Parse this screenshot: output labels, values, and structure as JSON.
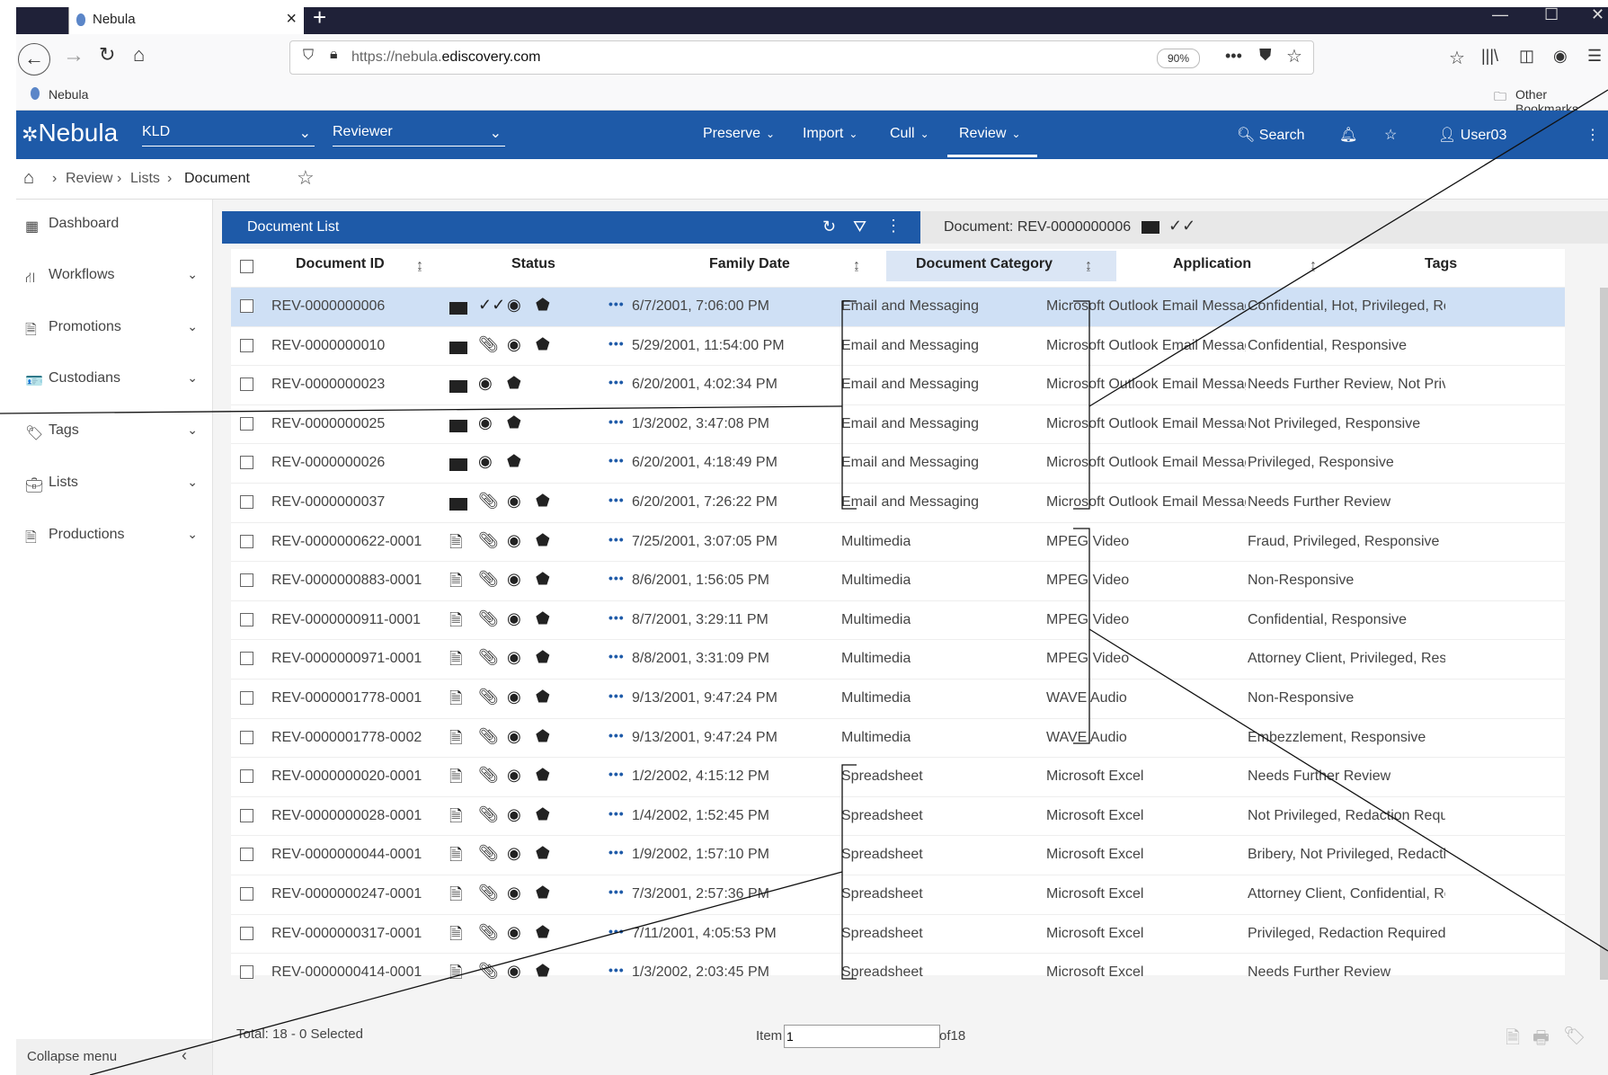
{
  "browser": {
    "tab_title": "Nebula",
    "url_prefix": "https://nebula.",
    "url_domain": "ediscovery.com",
    "zoom": "90%",
    "bookmark": "Nebula",
    "other_bookmarks": "Other Bookmarks"
  },
  "header": {
    "logo": "Nebula",
    "org": "KLD",
    "role": "Reviewer",
    "nav": [
      "Preserve",
      "Import",
      "Cull",
      "Review"
    ],
    "search": "Search",
    "user": "User03"
  },
  "breadcrumb": [
    "Review",
    "Lists",
    "Document"
  ],
  "sidebar": {
    "items": [
      {
        "label": "Dashboard",
        "icon": "dashboard-icon"
      },
      {
        "label": "Workflows",
        "icon": "sitemap-icon"
      },
      {
        "label": "Promotions",
        "icon": "file-icon"
      },
      {
        "label": "Custodians",
        "icon": "badge-icon"
      },
      {
        "label": "Tags",
        "icon": "tag-icon"
      },
      {
        "label": "Lists",
        "icon": "briefcase-icon"
      },
      {
        "label": "Productions",
        "icon": "file-export-icon"
      }
    ],
    "collapse": "Collapse menu"
  },
  "doclist": {
    "title": "Document List",
    "doc_info": "Document: REV-0000000006"
  },
  "columns": [
    "Document ID",
    "Status",
    "Family Date",
    "Document Category",
    "Application",
    "Tags"
  ],
  "rows": [
    {
      "id": "REV-0000000006",
      "date": "6/7/2001, 7:06:00 PM",
      "cat": "Email and Messaging",
      "app": "Microsoft Outlook Email Message",
      "tags": "Confidential, Hot, Privileged, Re...",
      "type": "email",
      "clip": false,
      "check": true
    },
    {
      "id": "REV-0000000010",
      "date": "5/29/2001, 11:54:00 PM",
      "cat": "Email and Messaging",
      "app": "Microsoft Outlook Email Message",
      "tags": "Confidential, Responsive",
      "type": "email",
      "clip": true,
      "check": false
    },
    {
      "id": "REV-0000000023",
      "date": "6/20/2001, 4:02:34 PM",
      "cat": "Email and Messaging",
      "app": "Microsoft Outlook Email Message",
      "tags": "Needs Further Review, Not Privil...",
      "type": "email",
      "clip": false,
      "check": false
    },
    {
      "id": "REV-0000000025",
      "date": "1/3/2002, 3:47:08 PM",
      "cat": "Email and Messaging",
      "app": "Microsoft Outlook Email Message",
      "tags": "Not Privileged, Responsive",
      "type": "email",
      "clip": false,
      "check": false
    },
    {
      "id": "REV-0000000026",
      "date": "6/20/2001, 4:18:49 PM",
      "cat": "Email and Messaging",
      "app": "Microsoft Outlook Email Message",
      "tags": "Privileged, Responsive",
      "type": "email",
      "clip": false,
      "check": false
    },
    {
      "id": "REV-0000000037",
      "date": "6/20/2001, 7:26:22 PM",
      "cat": "Email and Messaging",
      "app": "Microsoft Outlook Email Message",
      "tags": "Needs Further Review",
      "type": "email",
      "clip": true,
      "check": false
    },
    {
      "id": "REV-0000000622-0001",
      "date": "7/25/2001, 3:07:05 PM",
      "cat": "Multimedia",
      "app": "MPEG Video",
      "tags": "Fraud, Privileged, Responsive",
      "type": "media",
      "clip": true,
      "check": false
    },
    {
      "id": "REV-0000000883-0001",
      "date": "8/6/2001, 1:56:05 PM",
      "cat": "Multimedia",
      "app": "MPEG Video",
      "tags": "Non-Responsive",
      "type": "media",
      "clip": true,
      "check": false
    },
    {
      "id": "REV-0000000911-0001",
      "date": "8/7/2001, 3:29:11 PM",
      "cat": "Multimedia",
      "app": "MPEG Video",
      "tags": "Confidential, Responsive",
      "type": "media",
      "clip": true,
      "check": false
    },
    {
      "id": "REV-0000000971-0001",
      "date": "8/8/2001, 3:31:09 PM",
      "cat": "Multimedia",
      "app": "MPEG Video",
      "tags": "Attorney Client, Privileged, Res...",
      "type": "media",
      "clip": true,
      "check": false
    },
    {
      "id": "REV-0000001778-0001",
      "date": "9/13/2001, 9:47:24 PM",
      "cat": "Multimedia",
      "app": "WAVE Audio",
      "tags": "Non-Responsive",
      "type": "media",
      "clip": true,
      "check": false
    },
    {
      "id": "REV-0000001778-0002",
      "date": "9/13/2001, 9:47:24 PM",
      "cat": "Multimedia",
      "app": "WAVE Audio",
      "tags": "Embezzlement, Responsive",
      "type": "media",
      "clip": true,
      "check": false
    },
    {
      "id": "REV-0000000020-0001",
      "date": "1/2/2002, 4:15:12 PM",
      "cat": "Spreadsheet",
      "app": "Microsoft Excel",
      "tags": "Needs Further Review",
      "type": "excel",
      "clip": true,
      "check": false
    },
    {
      "id": "REV-0000000028-0001",
      "date": "1/4/2002, 1:52:45 PM",
      "cat": "Spreadsheet",
      "app": "Microsoft Excel",
      "tags": "Not Privileged, Redaction Requi...",
      "type": "excel",
      "clip": true,
      "check": false
    },
    {
      "id": "REV-0000000044-0001",
      "date": "1/9/2002, 1:57:10 PM",
      "cat": "Spreadsheet",
      "app": "Microsoft Excel",
      "tags": "Bribery, Not Privileged, Redacti...",
      "type": "excel",
      "clip": true,
      "check": false
    },
    {
      "id": "REV-0000000247-0001",
      "date": "7/3/2001, 2:57:36 PM",
      "cat": "Spreadsheet",
      "app": "Microsoft Excel",
      "tags": "Attorney Client, Confidential, Re...",
      "type": "excel",
      "clip": true,
      "check": false
    },
    {
      "id": "REV-0000000317-0001",
      "date": "7/11/2001, 4:05:53 PM",
      "cat": "Spreadsheet",
      "app": "Microsoft Excel",
      "tags": "Privileged, Redaction Required, ...",
      "type": "excel",
      "clip": true,
      "check": false
    },
    {
      "id": "REV-0000000414-0001",
      "date": "1/3/2002, 2:03:45 PM",
      "cat": "Spreadsheet",
      "app": "Microsoft Excel",
      "tags": "Needs Further Review",
      "type": "excel",
      "clip": true,
      "check": false
    }
  ],
  "footer": {
    "total": "Total: 18 - 0 Selected",
    "item_label": "Item",
    "item_value": "1",
    "of": "of18"
  }
}
